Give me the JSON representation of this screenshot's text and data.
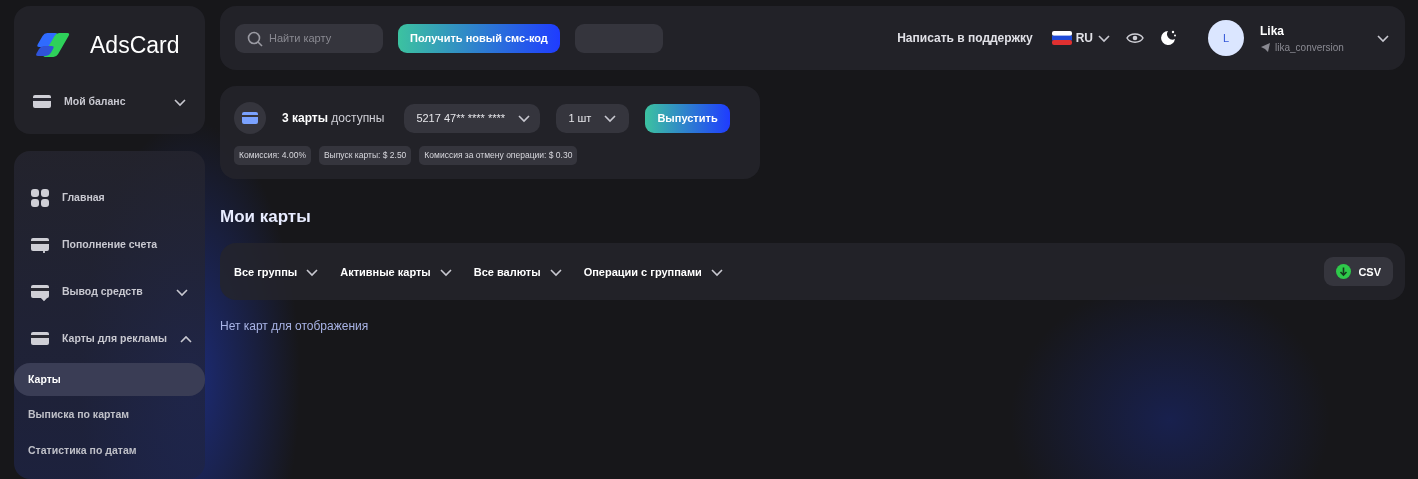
{
  "brand": {
    "name": "AdsCard"
  },
  "balance": {
    "label": "Мой баланс",
    "expanded": false
  },
  "nav": [
    {
      "label": "Главная",
      "kind": "link"
    },
    {
      "label": "Пополнение счета",
      "kind": "link"
    },
    {
      "label": "Вывод средств",
      "kind": "group",
      "expanded": false
    },
    {
      "label": "Карты для рекламы",
      "kind": "group",
      "expanded": true,
      "children": [
        {
          "label": "Карты",
          "selected": true
        },
        {
          "label": "Выписка по картам",
          "selected": false
        },
        {
          "label": "Статистика по датам",
          "selected": false
        }
      ]
    }
  ],
  "header": {
    "search": {
      "placeholder": "Найти карту"
    },
    "sms_button": "Получить новый смс-код",
    "support": "Написать в поддержку",
    "language": "RU",
    "user": {
      "initial": "L",
      "name": "Lika",
      "handle": "lika_conversion"
    }
  },
  "issue": {
    "available": "**3 карты** доступны",
    "card_select": "5217 47** **** ****",
    "quantity": "1 шт",
    "button": "Выпустить",
    "fees": [
      "Комиссия: 4.00%",
      "Выпуск карты: $ 2.50",
      "Комиссия за отмену операции: $ 0.30"
    ]
  },
  "title": "Мои карты",
  "filters": [
    "Все группы",
    "Активные карты",
    "Все валюты",
    "Операции с группами"
  ],
  "csv_button": "CSV",
  "empty_message": "Нет карт для отображения"
}
